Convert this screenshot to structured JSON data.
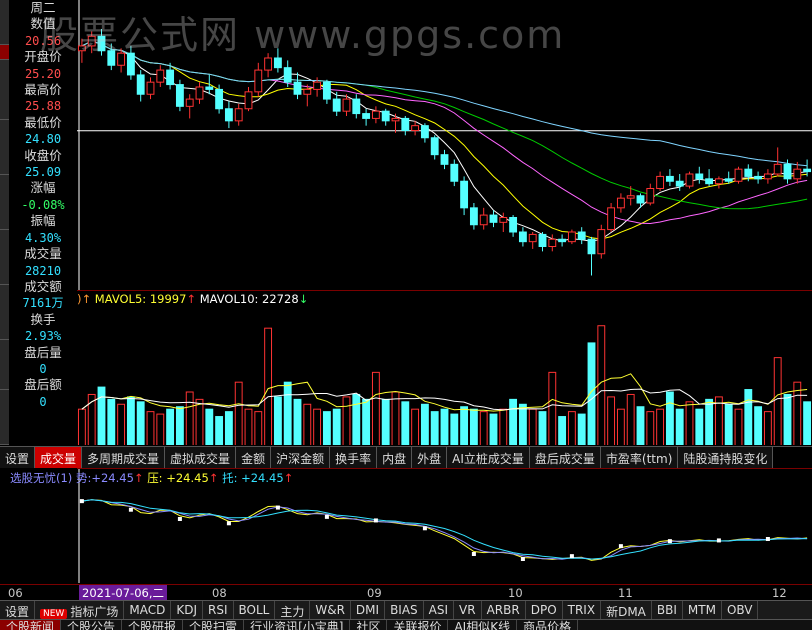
{
  "watermark": "股票公式网 www.gpgs.com",
  "colors": {
    "up": "#ff3333",
    "down": "#54ffff",
    "ma5": "#ffffff",
    "ma10": "#ffff00",
    "ma20": "#ff66ff",
    "ma30": "#00cc00",
    "ma60": "#7fd4ff",
    "price_line": "#ffffff"
  },
  "info": {
    "weekday": "周二",
    "numeric_label": "数值",
    "numeric_value": "20.56",
    "rows": [
      {
        "label": "开盘价",
        "value": "25.20",
        "color": "#ff4d4d"
      },
      {
        "label": "最高价",
        "value": "25.88",
        "color": "#ff4d4d"
      },
      {
        "label": "最低价",
        "value": "24.80",
        "color": "#33e0ff"
      },
      {
        "label": "收盘价",
        "value": "25.09",
        "color": "#33e0ff"
      },
      {
        "label": "涨幅",
        "value": "-0.08%",
        "color": "#33ff66"
      },
      {
        "label": "振幅",
        "value": "4.30%",
        "color": "#33e0ff"
      },
      {
        "label": "成交量",
        "value": "28210",
        "color": "#33e0ff"
      },
      {
        "label": "成交额",
        "value": "7161万",
        "color": "#33e0ff"
      },
      {
        "label": "换手",
        "value": "2.93%",
        "color": "#33e0ff"
      },
      {
        "label": "盘后量",
        "value": "0",
        "color": "#33e0ff"
      },
      {
        "label": "盘后额",
        "value": "0",
        "color": "#33e0ff"
      }
    ]
  },
  "volume_legend": {
    "prefix": ")↑",
    "mavol5_label": "MAVOL5:",
    "mavol5_value": "19997",
    "arrow5": "↑",
    "mavol10_label": "MAVOL10:",
    "mavol10_value": "22728",
    "arrow10": "↓"
  },
  "indicator_legend": {
    "name": "选股无忧(1)",
    "shi_label": "势:",
    "shi_value": "+24.45",
    "ya_label": "压:",
    "ya_value": "+24.45",
    "tuo_label": "托:",
    "tuo_value": "+24.45",
    "arrow": "↑"
  },
  "volume_tabs": [
    {
      "label": "设置",
      "active": false
    },
    {
      "label": "成交量",
      "active": true
    },
    {
      "label": "多周期成交量",
      "active": false
    },
    {
      "label": "虚拟成交量",
      "active": false
    },
    {
      "label": "金额",
      "active": false
    },
    {
      "label": "沪深金额",
      "active": false
    },
    {
      "label": "换手率",
      "active": false
    },
    {
      "label": "内盘",
      "active": false
    },
    {
      "label": "外盘",
      "active": false
    },
    {
      "label": "AI立桩成交量",
      "active": false
    },
    {
      "label": "盘后成交量",
      "active": false
    },
    {
      "label": "市盈率(ttm)",
      "active": false
    },
    {
      "label": "陆股通持股变化",
      "active": false
    }
  ],
  "date_axis": {
    "ticks": [
      "06",
      "08",
      "09",
      "10",
      "11",
      "12"
    ],
    "cursor_date": "2021-07-06,二"
  },
  "indicator_tabs": [
    {
      "label": "设置",
      "badge": ""
    },
    {
      "label": "指标广场",
      "badge": "NEW"
    },
    {
      "label": "MACD",
      "badge": ""
    },
    {
      "label": "KDJ",
      "badge": ""
    },
    {
      "label": "RSI",
      "badge": ""
    },
    {
      "label": "BOLL",
      "badge": ""
    },
    {
      "label": "主力",
      "badge": ""
    },
    {
      "label": "W&R",
      "badge": ""
    },
    {
      "label": "DMI",
      "badge": ""
    },
    {
      "label": "BIAS",
      "badge": ""
    },
    {
      "label": "ASI",
      "badge": ""
    },
    {
      "label": "VR",
      "badge": ""
    },
    {
      "label": "ARBR",
      "badge": ""
    },
    {
      "label": "DPO",
      "badge": ""
    },
    {
      "label": "TRIX",
      "badge": ""
    },
    {
      "label": "新DMA",
      "badge": ""
    },
    {
      "label": "BBI",
      "badge": ""
    },
    {
      "label": "MTM",
      "badge": ""
    },
    {
      "label": "OBV",
      "badge": ""
    }
  ],
  "news_tabs": [
    {
      "label": "个股新闻",
      "active": true
    },
    {
      "label": "个股公告",
      "active": false
    },
    {
      "label": "个股研报",
      "active": false
    },
    {
      "label": "个股扫雷",
      "active": false
    },
    {
      "label": "行业资讯[小宝典]",
      "active": false
    },
    {
      "label": "社区",
      "active": false
    },
    {
      "label": "关联报价",
      "active": false
    },
    {
      "label": "AI相似K线",
      "active": false
    },
    {
      "label": "商品价格",
      "active": false
    }
  ],
  "chart_data": {
    "type": "candlestick",
    "note_scale": "price axis not printed",
    "candles": [
      [
        28.4,
        28.9,
        27.9,
        28.6
      ],
      [
        28.6,
        29.2,
        28.3,
        29.0
      ],
      [
        29.0,
        29.3,
        28.2,
        28.4
      ],
      [
        28.4,
        28.7,
        27.6,
        27.8
      ],
      [
        27.8,
        28.5,
        27.5,
        28.3
      ],
      [
        28.3,
        28.6,
        27.2,
        27.4
      ],
      [
        27.4,
        27.6,
        26.3,
        26.6
      ],
      [
        26.6,
        27.3,
        26.4,
        27.1
      ],
      [
        27.1,
        27.8,
        26.9,
        27.6
      ],
      [
        27.6,
        27.9,
        26.8,
        27.0
      ],
      [
        27.0,
        27.2,
        25.9,
        26.1
      ],
      [
        26.1,
        26.6,
        25.6,
        26.4
      ],
      [
        26.4,
        27.1,
        26.2,
        26.9
      ],
      [
        26.9,
        27.4,
        26.6,
        26.8
      ],
      [
        26.8,
        27.0,
        25.8,
        26.0
      ],
      [
        26.0,
        26.3,
        25.2,
        25.5
      ],
      [
        25.5,
        26.2,
        25.3,
        26.0
      ],
      [
        26.0,
        26.9,
        25.9,
        26.7
      ],
      [
        26.7,
        27.9,
        26.5,
        27.6
      ],
      [
        27.6,
        28.3,
        27.3,
        28.1
      ],
      [
        28.1,
        28.5,
        27.5,
        27.7
      ],
      [
        27.7,
        28.0,
        26.9,
        27.1
      ],
      [
        27.1,
        27.5,
        26.4,
        26.6
      ],
      [
        26.6,
        27.0,
        26.1,
        26.8
      ],
      [
        26.8,
        27.3,
        26.5,
        27.1
      ],
      [
        27.1,
        27.2,
        26.2,
        26.4
      ],
      [
        26.4,
        26.7,
        25.7,
        25.9
      ],
      [
        25.9,
        26.6,
        25.7,
        26.4
      ],
      [
        26.4,
        26.6,
        25.6,
        25.8
      ],
      [
        25.8,
        26.0,
        25.3,
        25.6
      ],
      [
        25.6,
        26.1,
        25.4,
        25.9
      ],
      [
        25.9,
        26.0,
        25.3,
        25.5
      ],
      [
        25.5,
        25.8,
        25.0,
        25.6
      ],
      [
        25.6,
        25.7,
        24.9,
        25.1
      ],
      [
        25.1,
        25.5,
        24.9,
        25.3
      ],
      [
        25.3,
        25.4,
        24.6,
        24.8
      ],
      [
        24.8,
        24.9,
        23.9,
        24.1
      ],
      [
        24.1,
        24.3,
        23.5,
        23.7
      ],
      [
        23.7,
        23.9,
        22.8,
        23.0
      ],
      [
        23.0,
        23.2,
        21.6,
        21.9
      ],
      [
        21.9,
        22.1,
        21.0,
        21.2
      ],
      [
        21.2,
        21.9,
        21.0,
        21.6
      ],
      [
        21.6,
        21.8,
        21.1,
        21.3
      ],
      [
        21.3,
        21.7,
        20.9,
        21.5
      ],
      [
        21.5,
        21.6,
        20.7,
        20.9
      ],
      [
        20.9,
        21.1,
        20.3,
        20.5
      ],
      [
        20.5,
        20.9,
        20.2,
        20.8
      ],
      [
        20.8,
        20.9,
        20.1,
        20.3
      ],
      [
        20.3,
        20.8,
        20.1,
        20.6
      ],
      [
        20.6,
        20.8,
        20.3,
        20.5
      ],
      [
        20.5,
        21.0,
        20.4,
        20.9
      ],
      [
        20.9,
        21.1,
        20.4,
        20.6
      ],
      [
        20.6,
        20.7,
        19.1,
        20.0
      ],
      [
        20.0,
        21.2,
        19.8,
        21.0
      ],
      [
        21.0,
        22.1,
        20.9,
        21.9
      ],
      [
        21.9,
        22.5,
        21.7,
        22.3
      ],
      [
        22.3,
        22.8,
        22.0,
        22.4
      ],
      [
        22.4,
        22.5,
        21.9,
        22.1
      ],
      [
        22.1,
        22.9,
        22.0,
        22.7
      ],
      [
        22.7,
        23.4,
        22.6,
        23.2
      ],
      [
        23.2,
        23.5,
        22.8,
        23.0
      ],
      [
        23.0,
        23.3,
        22.6,
        22.8
      ],
      [
        22.8,
        23.4,
        22.7,
        23.3
      ],
      [
        23.3,
        23.6,
        22.9,
        23.1
      ],
      [
        23.1,
        23.5,
        22.8,
        22.9
      ],
      [
        22.9,
        23.2,
        22.7,
        23.1
      ],
      [
        23.1,
        23.4,
        22.9,
        23.0
      ],
      [
        23.0,
        23.6,
        22.9,
        23.5
      ],
      [
        23.5,
        23.7,
        23.0,
        23.2
      ],
      [
        23.2,
        23.4,
        22.9,
        23.1
      ],
      [
        23.1,
        23.5,
        22.9,
        23.3
      ],
      [
        23.3,
        24.4,
        23.2,
        23.7
      ],
      [
        23.7,
        23.9,
        22.9,
        23.1
      ],
      [
        23.1,
        23.8,
        22.9,
        23.5
      ],
      [
        23.5,
        23.9,
        23.2,
        23.4
      ]
    ],
    "volume": [
      30,
      42,
      48,
      38,
      34,
      40,
      36,
      28,
      26,
      30,
      32,
      44,
      38,
      30,
      24,
      28,
      52,
      30,
      28,
      96,
      40,
      52,
      38,
      34,
      30,
      28,
      30,
      40,
      42,
      38,
      60,
      38,
      44,
      36,
      30,
      34,
      28,
      30,
      26,
      32,
      30,
      28,
      26,
      30,
      38,
      34,
      30,
      28,
      60,
      24,
      28,
      26,
      84,
      98,
      40,
      30,
      42,
      32,
      28,
      30,
      44,
      30,
      36,
      30,
      38,
      40,
      34,
      30,
      46,
      32,
      28,
      72,
      42,
      52,
      36
    ],
    "mavol5_last": 19997,
    "mavol10_last": 22728,
    "indicator_last": {
      "shi": 24.45,
      "ya": 24.45,
      "tuo": 24.45
    },
    "date_ticks": [
      "06",
      "08",
      "09",
      "10",
      "11",
      "12"
    ]
  }
}
